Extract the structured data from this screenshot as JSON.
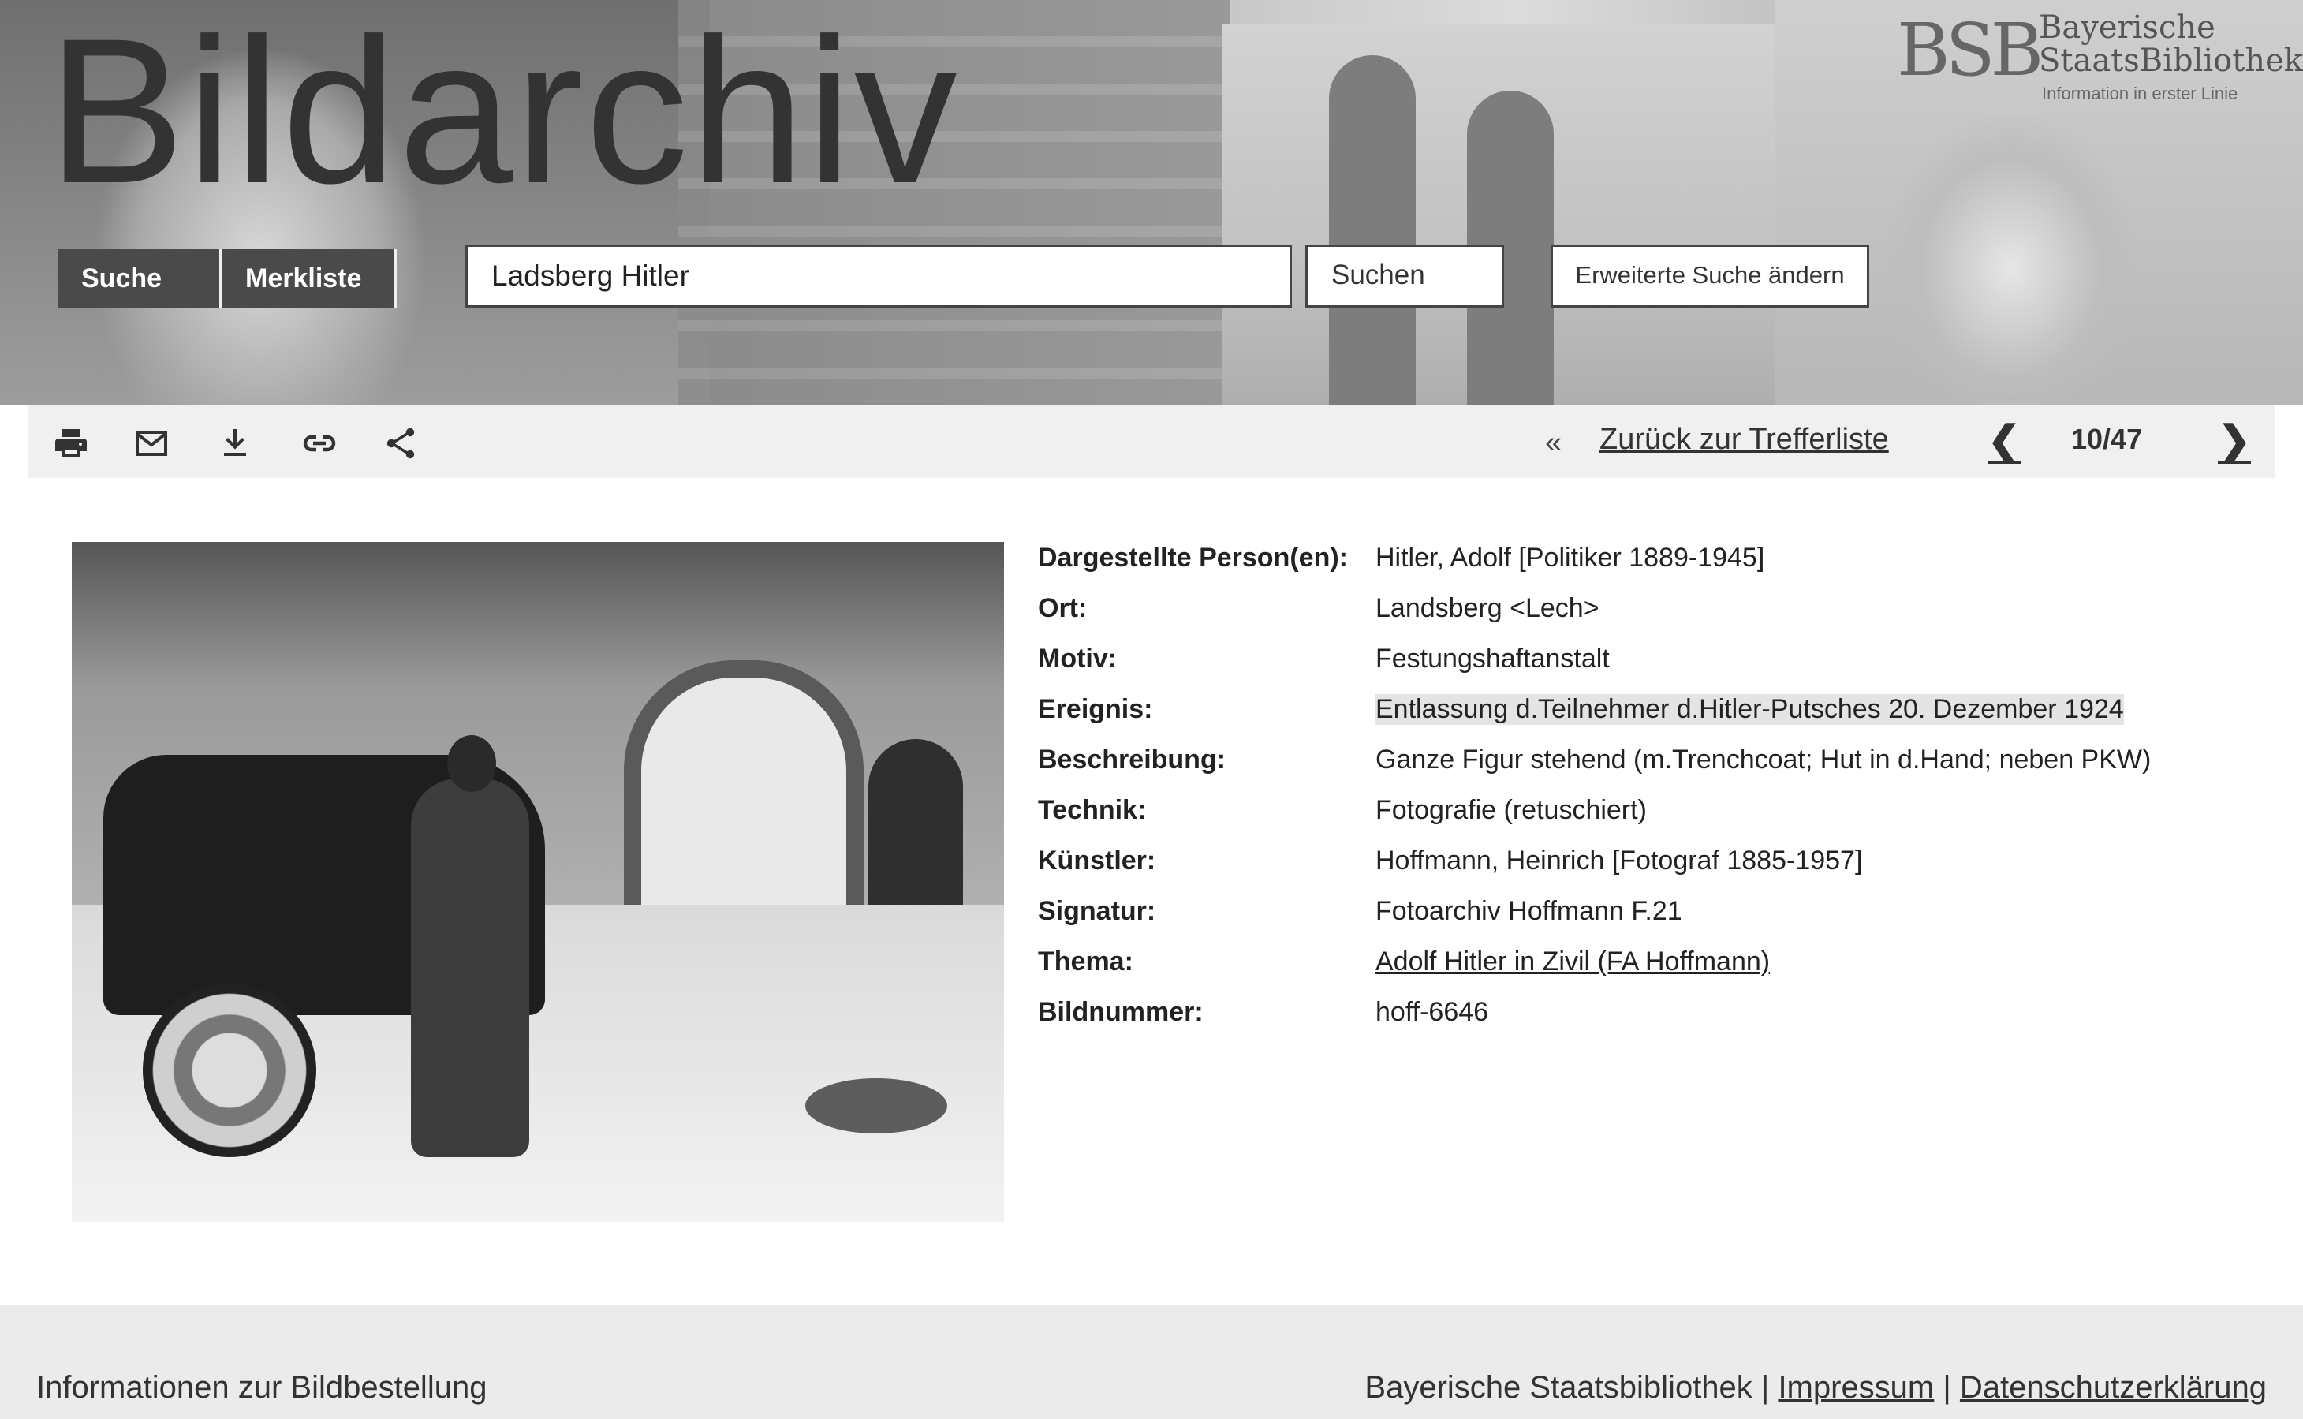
{
  "header": {
    "site_title": "Bildarchiv",
    "logo_mark": "BSB",
    "logo_name_line1": "Bayerische",
    "logo_name_line2": "StaatsBibliothek",
    "logo_claim": "Information in erster Linie"
  },
  "nav": {
    "search_label": "Suche",
    "watchlist_label": "Merkliste"
  },
  "search": {
    "value": "Ladsberg Hitler",
    "button_label": "Suchen",
    "advanced_label": "Erweiterte Suche ändern"
  },
  "toolbar": {
    "icons": [
      "print-icon",
      "mail-icon",
      "download-icon",
      "link-icon",
      "share-icon"
    ],
    "back_chevrons": "‹‹",
    "back_label": "Zurück zur Trefferliste",
    "prev_glyph": "❮",
    "counter": "10/47",
    "next_glyph": "❯"
  },
  "metadata": [
    {
      "label": "Dargestellte Person(en):",
      "value": "Hitler, Adolf [Politiker 1889-1945]"
    },
    {
      "label": "Ort:",
      "value": "Landsberg <Lech>"
    },
    {
      "label": "Motiv:",
      "value": "Festungshaftanstalt"
    },
    {
      "label": "Ereignis:",
      "value": "Entlassung d.Teilnehmer d.Hitler-Putsches 20. Dezember 1924"
    },
    {
      "label": "Beschreibung:",
      "value": "Ganze Figur stehend (m.Trenchcoat; Hut in d.Hand; neben PKW)"
    },
    {
      "label": "Technik:",
      "value": "Fotografie (retuschiert)"
    },
    {
      "label": "Künstler:",
      "value": "Hoffmann, Heinrich [Fotograf 1885-1957]"
    },
    {
      "label": "Signatur:",
      "value": "Fotoarchiv Hoffmann F.21"
    },
    {
      "label": "Thema:",
      "value": "Adolf Hitler in Zivil (FA Hoffmann)"
    },
    {
      "label": "Bildnummer:",
      "value": "hoff-6646"
    }
  ],
  "footer": {
    "info_label": "Informationen zur Bildbestellung",
    "library_label": "Bayerische Staatsbibliothek",
    "separator": "|",
    "imprint_label": "Impressum",
    "privacy_label": "Datenschutzerklärung"
  },
  "colors": {
    "nav_bg": "#4a4a4a",
    "toolbar_bg": "#f0f0f0",
    "footer_bg": "#ebebeb",
    "logo_accent": "#c8242b",
    "highlight_bg": "#e4e4e4"
  }
}
